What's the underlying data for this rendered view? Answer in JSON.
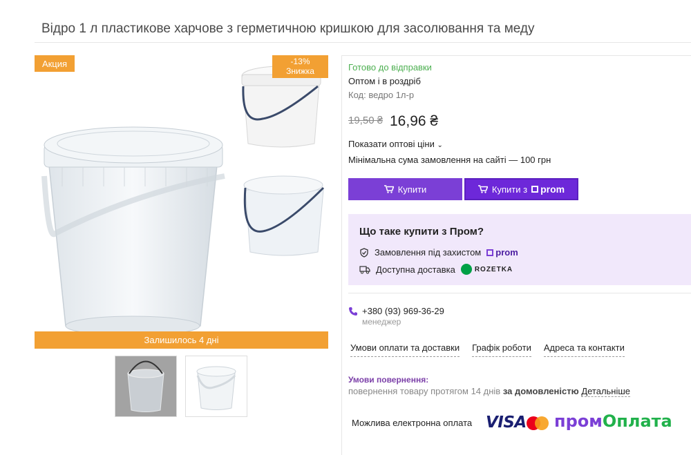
{
  "product": {
    "title": "Відро 1 л пластикове харчове з герметичною кришкою для засолювання та меду"
  },
  "gallery": {
    "badge_sale": "Акция",
    "badge_discount_line1": "-13%",
    "badge_discount_line2": "Знижка",
    "remaining": "Залишилось 4 дні"
  },
  "info": {
    "availability": "Готово до відправки",
    "sale_type": "Оптом і в роздріб",
    "code": "Код: ведро 1л-р",
    "old_price": "19,50 ₴",
    "new_price": "16,96 ₴",
    "show_wholesale": "Показати оптові ціни",
    "min_order": "Мінімальна сума замовлення на сайті — 100 грн",
    "buy_label": "Купити",
    "buy_prom_label": "Купити з",
    "prom_word": "prom"
  },
  "prom_box": {
    "title": "Що таке купити з Пром?",
    "row1": "Замовлення під захистом",
    "row1_logo": "prom",
    "row2": "Доступна доставка",
    "row2_logo": "ROZETKA"
  },
  "contact": {
    "phone": "+380 (93) 969-36-29",
    "role": "менеджер"
  },
  "links": [
    "Умови оплати та доставки",
    "Графік роботи",
    "Адреса та контакти"
  ],
  "returns": {
    "title": "Умови повернення:",
    "text": "повернення товару протягом 14 днів",
    "text_bold": "за домовленістю",
    "more": "Детальніше"
  },
  "payment": {
    "label": "Можлива електронна оплата",
    "visa": "VISA",
    "promoplata_1": "пром",
    "promoplata_2": "Оплата"
  },
  "colors": {
    "accent_orange": "#f2a033",
    "prom_purple": "#7b3fd6",
    "ready_green": "#4caf50",
    "prom_box_bg": "#f1e8fb"
  }
}
